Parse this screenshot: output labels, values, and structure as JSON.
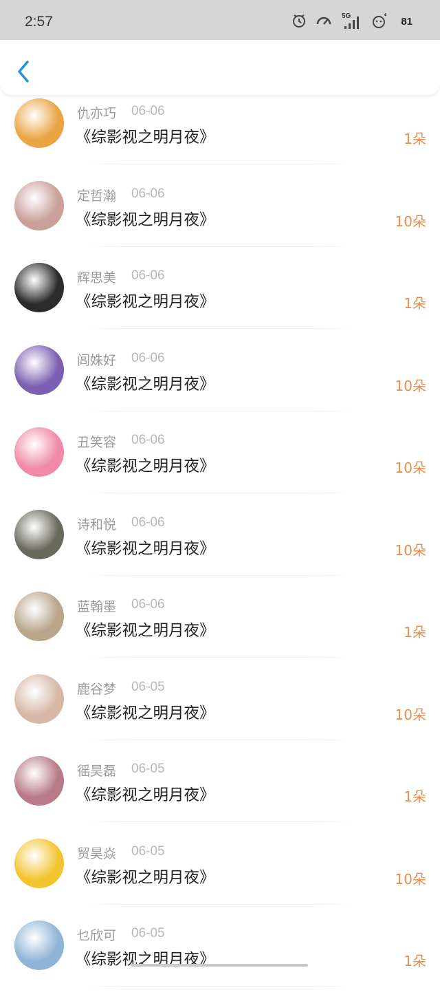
{
  "status_bar": {
    "time": "2:57",
    "network": "5G",
    "battery": "81",
    "icons": [
      "alarm-icon",
      "speedometer-icon",
      "signal-icon",
      "pet-icon",
      "battery-icon"
    ]
  },
  "nav": {
    "back_icon": "chevron-left-icon",
    "back_color": "#2a8fd8"
  },
  "items": [
    {
      "name": "仇亦巧",
      "date": "06-06",
      "title": "《综影视之明月夜》",
      "count": "1朵",
      "avatar_color": "#e9a544"
    },
    {
      "name": "定哲瀚",
      "date": "06-06",
      "title": "《综影视之明月夜》",
      "count": "10朵",
      "avatar_color": "#c9a09a"
    },
    {
      "name": "辉思美",
      "date": "06-06",
      "title": "《综影视之明月夜》",
      "count": "1朵",
      "avatar_color": "#2b2b2b"
    },
    {
      "name": "闾姝好",
      "date": "06-06",
      "title": "《综影视之明月夜》",
      "count": "10朵",
      "avatar_color": "#7c5fb3"
    },
    {
      "name": "丑笑容",
      "date": "06-06",
      "title": "《综影视之明月夜》",
      "count": "10朵",
      "avatar_color": "#f08aa6"
    },
    {
      "name": "诗和悦",
      "date": "06-06",
      "title": "《综影视之明月夜》",
      "count": "10朵",
      "avatar_color": "#6a6a5c"
    },
    {
      "name": "蓝翰墨",
      "date": "06-06",
      "title": "《综影视之明月夜》",
      "count": "1朵",
      "avatar_color": "#b8a58a"
    },
    {
      "name": "鹿谷梦",
      "date": "06-05",
      "title": "《综影视之明月夜》",
      "count": "10朵",
      "avatar_color": "#d7b8a6"
    },
    {
      "name": "徭昊磊",
      "date": "06-05",
      "title": "《综影视之明月夜》",
      "count": "1朵",
      "avatar_color": "#b87a86"
    },
    {
      "name": "贸昊焱",
      "date": "06-05",
      "title": "《综影视之明月夜》",
      "count": "10朵",
      "avatar_color": "#f2c530"
    },
    {
      "name": "乜欣可",
      "date": "06-05",
      "title": "《综影视之明月夜》",
      "count": "1朵",
      "avatar_color": "#8fb4d6"
    }
  ]
}
